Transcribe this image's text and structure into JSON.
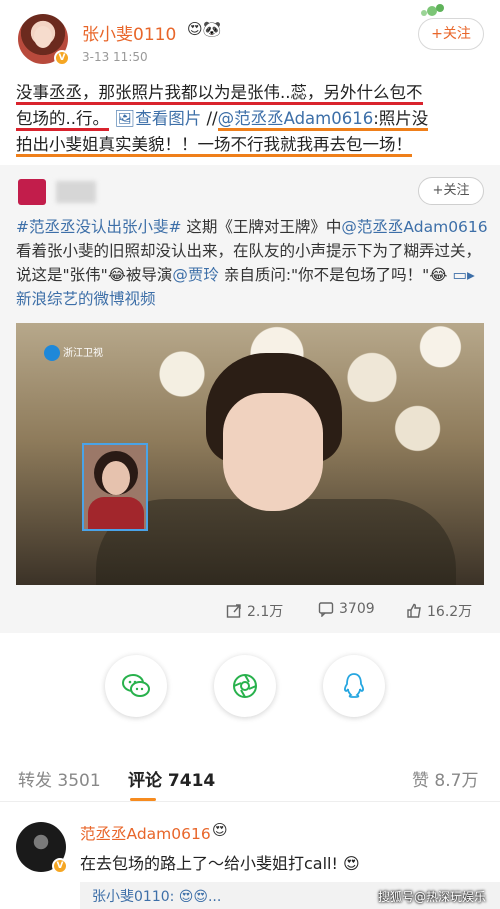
{
  "header": {
    "username": "张小斐0110",
    "user_icons": "😍🐼",
    "time": "3-13 11:50",
    "follow_label": "+关注"
  },
  "post": {
    "text_red1": "没事丞丞，那张照片我都以为是张伟..蕊，另外什么包不",
    "text_red2": "包场的..行。",
    "view_image_label": "查看图片",
    "separator": " //",
    "mention": "@范丞丞Adam0616",
    "text_orange1": ":照片没",
    "text_orange2": "拍出小斐姐真实美貌！！一场不行我就我再去包一场！"
  },
  "repost": {
    "follow_label": "+关注",
    "hashtag": "#范丞丞没认出张小斐#",
    "text1": " 这期《王牌对王牌》中",
    "mention1": "@范丞丞Adam0616",
    "text2": " 看着张小斐的旧照却没认出来，在队友的小声提示下为了糊弄过关，说这是\"张伟\"😂被导演",
    "mention2": "@贾玲",
    "text3": " 亲自质问:\"你不是包场了吗！\"😂 ",
    "video_link": "新浪综艺的微博视频",
    "tv_logo": "浙江卫视",
    "stats": {
      "repost": "2.1万",
      "comment": "3709",
      "like": "16.2万"
    }
  },
  "tabs": {
    "repost_label": "转发",
    "repost_count": "3501",
    "comment_label": "评论",
    "comment_count": "7414",
    "like_label": "赞",
    "like_count": "8.7万"
  },
  "comment": {
    "name": "范丞丞Adam0616",
    "crown": "😍",
    "text": "在去包场的路上了～给小斐姐打call! 😍",
    "reply": "张小斐0110: 😍😍..."
  },
  "watermark": "搜狐号@热深玩娱乐",
  "colors": {
    "accent_orange": "#e8662a",
    "link_blue": "#3d6fa8",
    "underline_red": "#d9232d",
    "underline_orange": "#ef7f1a"
  }
}
